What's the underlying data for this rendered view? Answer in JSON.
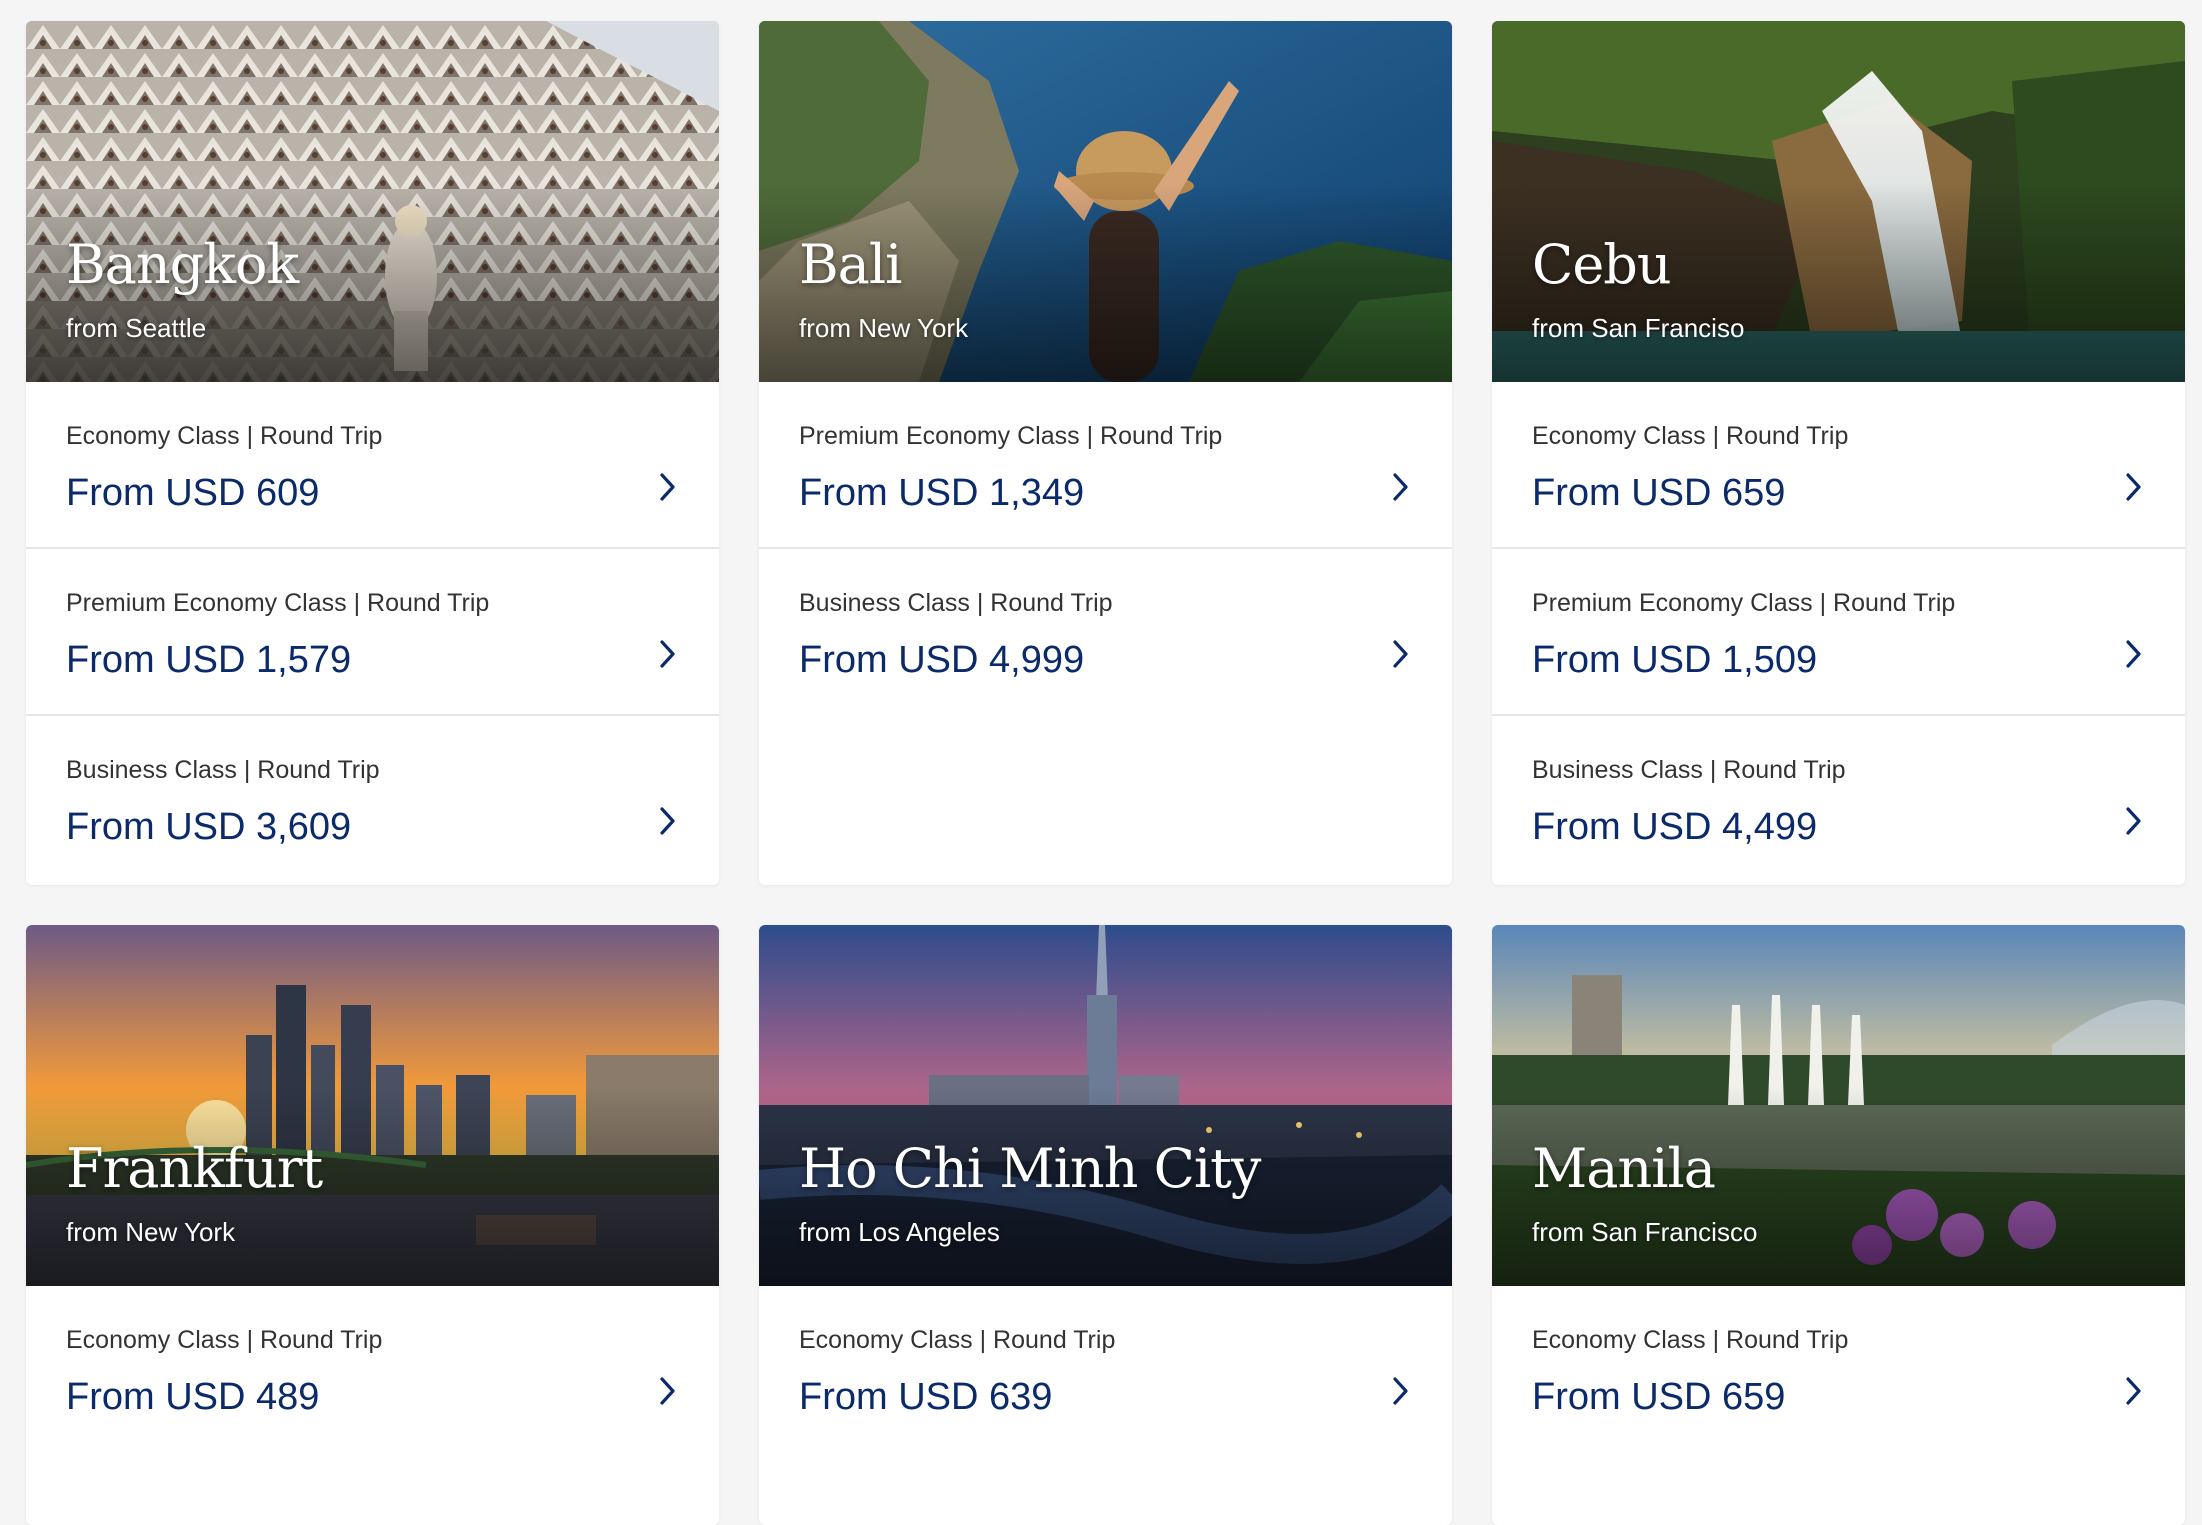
{
  "brand_colors": {
    "price": "#0b2a6b",
    "label": "#333333",
    "background": "#f5f5f5"
  },
  "chevron_icon": "chevron-right-icon",
  "destinations": [
    {
      "city": "Bangkok",
      "origin": "from Seattle",
      "fares": [
        {
          "cabin": "Economy Class | Round Trip",
          "price": "From USD 609"
        },
        {
          "cabin": "Premium Economy Class | Round Trip",
          "price": "From USD 1,579"
        },
        {
          "cabin": "Business Class | Round Trip",
          "price": "From USD 3,609"
        }
      ]
    },
    {
      "city": "Bali",
      "origin": "from New York",
      "fares": [
        {
          "cabin": "Premium Economy Class | Round Trip",
          "price": "From USD 1,349"
        },
        {
          "cabin": "Business Class | Round Trip",
          "price": "From USD 4,999"
        }
      ]
    },
    {
      "city": "Cebu",
      "origin": "from San Franciso",
      "fares": [
        {
          "cabin": "Economy Class | Round Trip",
          "price": "From USD 659"
        },
        {
          "cabin": "Premium Economy Class | Round Trip",
          "price": "From USD 1,509"
        },
        {
          "cabin": "Business Class | Round Trip",
          "price": "From USD 4,499"
        }
      ]
    },
    {
      "city": "Frankfurt",
      "origin": "from New York",
      "fares": [
        {
          "cabin": "Economy Class | Round Trip",
          "price": "From USD 489"
        }
      ]
    },
    {
      "city": "Ho Chi Minh City",
      "origin": "from Los Angeles",
      "fares": [
        {
          "cabin": "Economy Class | Round Trip",
          "price": "From USD 639"
        }
      ]
    },
    {
      "city": "Manila",
      "origin": "from San Francisco",
      "fares": [
        {
          "cabin": "Economy Class | Round Trip",
          "price": "From USD 659"
        }
      ]
    }
  ]
}
